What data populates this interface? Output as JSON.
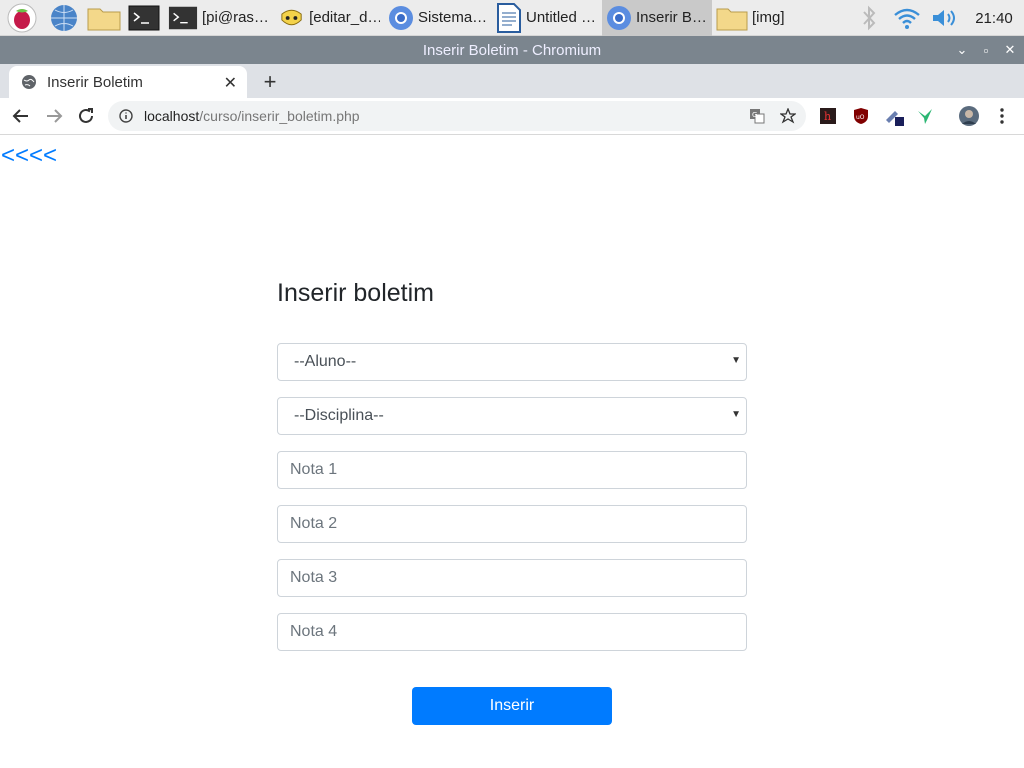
{
  "taskbar": {
    "tasks": [
      {
        "label": "[pi@ras…",
        "icon": "terminal-icon"
      },
      {
        "label": "[editar_d…",
        "icon": "geany-icon"
      },
      {
        "label": "Sistema…",
        "icon": "chromium-icon"
      },
      {
        "label": "Untitled …",
        "icon": "writer-document-icon"
      },
      {
        "label": "Inserir B…",
        "icon": "chromium-icon"
      },
      {
        "label": "[img]",
        "icon": "folder-icon"
      }
    ],
    "clock": "21:40"
  },
  "window": {
    "title": "Inserir Boletim - Chromium"
  },
  "browser": {
    "tab_title": "Inserir Boletim",
    "url_host": "localhost",
    "url_path": "/curso/inserir_boletim.php"
  },
  "page": {
    "back_link": "<<<<",
    "title": "Inserir boletim",
    "select_aluno": "--Aluno--",
    "select_disciplina": "--Disciplina--",
    "nota1_placeholder": "Nota 1",
    "nota2_placeholder": "Nota 2",
    "nota3_placeholder": "Nota 3",
    "nota4_placeholder": "Nota 4",
    "submit_label": "Inserir"
  },
  "colors": {
    "accent": "#007bff",
    "titlebar": "#7b858e"
  }
}
